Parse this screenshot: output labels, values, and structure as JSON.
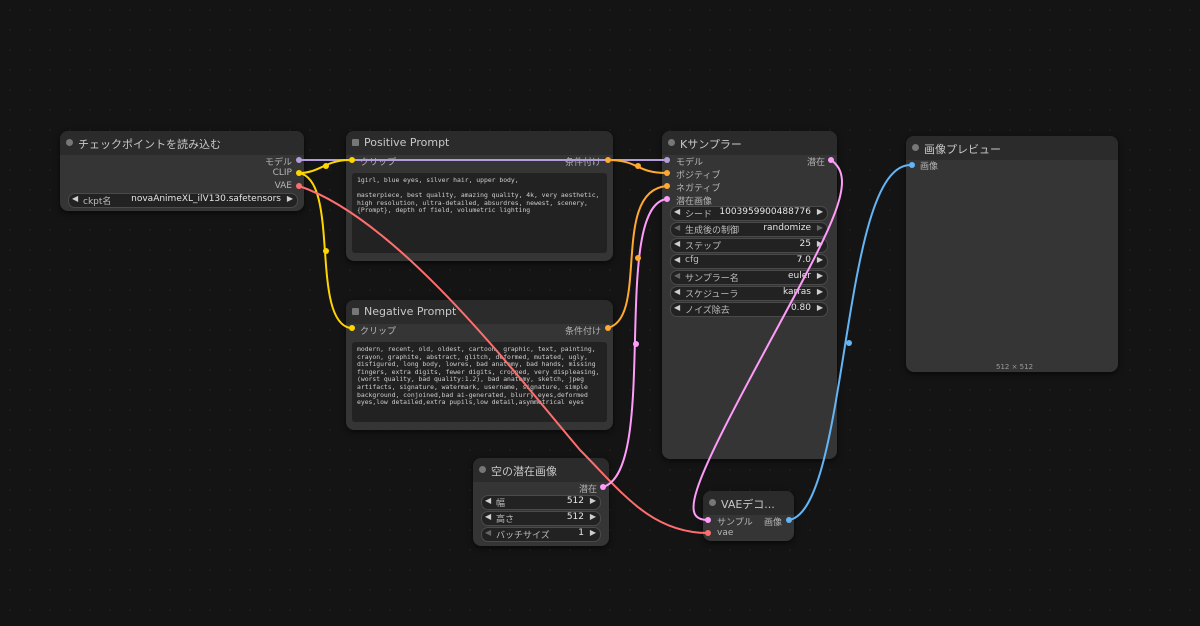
{
  "nodes": {
    "checkpoint": {
      "title": "チェックポイントを読み込む",
      "outputs": [
        "モデル",
        "CLIP",
        "VAE"
      ],
      "widget": {
        "label": "ckpt名",
        "value": "novaAnimeXL_ilV130.safetensors"
      }
    },
    "positive": {
      "title": "Positive Prompt",
      "input": "クリップ",
      "output": "条件付け",
      "text": "1girl, blue eyes, silver hair, upper body,\n\nmasterpiece, best quality, amazing quality, 4k, very aesthetic, high resolution, ultra-detailed, absurdres, newest, scenery, {Prompt}, depth of field, volumetric lighting"
    },
    "negative": {
      "title": "Negative Prompt",
      "input": "クリップ",
      "output": "条件付け",
      "text": "modern, recent, old, oldest, cartoon, graphic, text, painting, crayon, graphite, abstract, glitch, deformed, mutated, ugly, disfigured, long body, lowres, bad anatomy, bad hands, missing fingers, extra digits, fewer digits, cropped, very displeasing, (worst quality, bad quality:1.2), bad anatomy, sketch, jpeg artifacts, signature, watermark, username, signature, simple background, conjoined,bad ai-generated, blurry eyes,deformed eyes,low detailed,extra pupils,low detail,asymmetrical eyes"
    },
    "ksampler": {
      "title": "Kサンプラー",
      "inputs": [
        "モデル",
        "ポジティブ",
        "ネガティブ",
        "潜在画像"
      ],
      "output": "潜在",
      "widgets": [
        {
          "label": "シード",
          "value": "1003959900488776"
        },
        {
          "label": "生成後の制御",
          "value": "randomize"
        },
        {
          "label": "ステップ",
          "value": "25"
        },
        {
          "label": "cfg",
          "value": "7.0"
        },
        {
          "label": "サンプラー名",
          "value": "euler"
        },
        {
          "label": "スケジューラ",
          "value": "karras"
        },
        {
          "label": "ノイズ除去",
          "value": "0.80"
        }
      ]
    },
    "preview": {
      "title": "画像プレビュー",
      "input": "画像",
      "caption": "512 × 512"
    },
    "empty_latent": {
      "title": "空の潜在画像",
      "output": "潜在",
      "widgets": [
        {
          "label": "幅",
          "value": "512"
        },
        {
          "label": "高さ",
          "value": "512"
        },
        {
          "label": "バッチサイズ",
          "value": "1"
        }
      ]
    },
    "vae_decode": {
      "title": "VAEデコ...",
      "inputs": [
        "サンプル",
        "vae"
      ],
      "output": "画像"
    }
  },
  "colors": {
    "model": "#b39ddb",
    "clip": "#ffd500",
    "vae": "#ff6e6e",
    "conditioning": "#ffa931",
    "latent": "#ff9cf9",
    "image": "#64b5f6"
  }
}
